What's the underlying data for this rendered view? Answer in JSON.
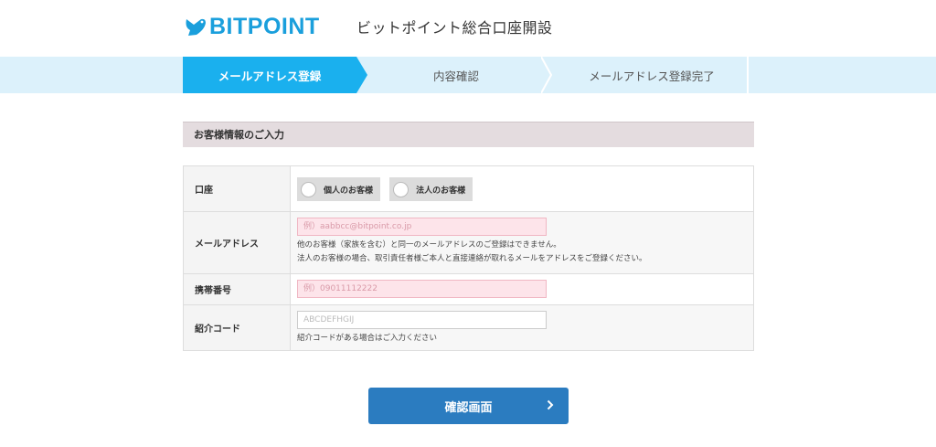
{
  "header": {
    "brand": "BITPOINT",
    "title": "ビットポイント総合口座開設",
    "brand_color": "#1a9fdc"
  },
  "steps": [
    {
      "label": "メールアドレス登録",
      "active": true
    },
    {
      "label": "内容確認",
      "active": false
    },
    {
      "label": "メールアドレス登録完了",
      "active": false
    }
  ],
  "section": {
    "title": "お客様情報のご入力"
  },
  "form": {
    "account": {
      "label": "口座",
      "options": [
        "個人のお客様",
        "法人のお客様"
      ]
    },
    "email": {
      "label": "メールアドレス",
      "placeholder": "例）aabbcc@bitpoint.co.jp",
      "help1": "他のお客様（家族を含む）と同一のメールアドレスのご登録はできません。",
      "help2": "法人のお客様の場合、取引責任者様ご本人と直接連絡が取れるメールをアドレスをご登録ください。"
    },
    "phone": {
      "label": "携帯番号",
      "placeholder": "例）09011112222"
    },
    "referral": {
      "label": "紹介コード",
      "placeholder": "ABCDEFHGIJ",
      "help": "紹介コードがある場合はご入力ください"
    }
  },
  "submit": {
    "label": "確認画面"
  },
  "colors": {
    "accent": "#1ab0ee",
    "step_bg": "#dcf1fb",
    "button": "#2b7cc0",
    "required_bg": "#fde4ea"
  }
}
